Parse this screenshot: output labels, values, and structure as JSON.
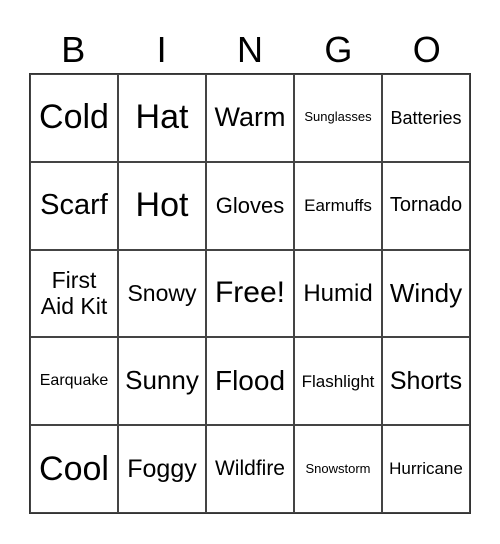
{
  "header": [
    "B",
    "I",
    "N",
    "G",
    "O"
  ],
  "cells": [
    "Cold",
    "Hat",
    "Warm",
    "Sunglasses",
    "Batteries",
    "Scarf",
    "Hot",
    "Gloves",
    "Earmuffs",
    "Tornado",
    "First\nAid Kit",
    "Snowy",
    "Free!",
    "Humid",
    "Windy",
    "Earquake",
    "Sunny",
    "Flood",
    "Flashlight",
    "Shorts",
    "Cool",
    "Foggy",
    "Wildfire",
    "Snowstorm",
    "Hurricane"
  ]
}
